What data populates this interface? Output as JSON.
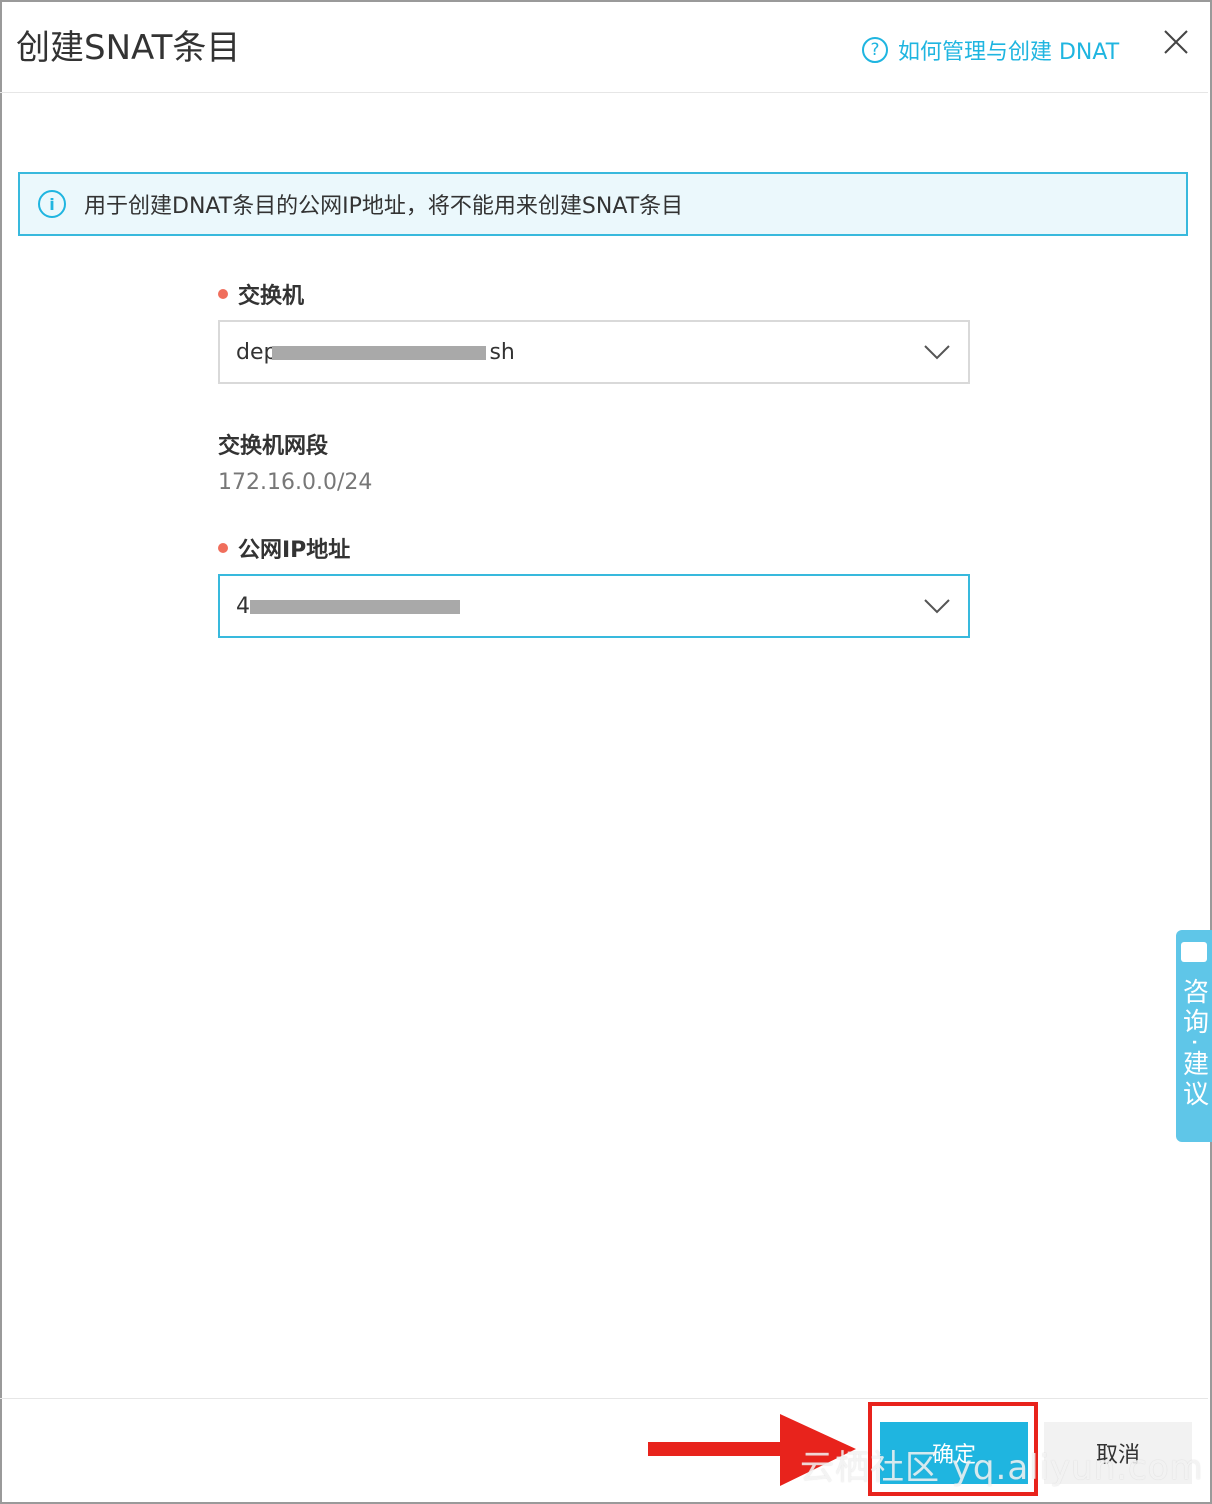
{
  "dialog": {
    "title": "创建SNAT条目",
    "help_link": "如何管理与创建 DNAT",
    "help_icon": "question-circle-icon",
    "close_icon": "close-icon"
  },
  "notice": {
    "icon": "info-circle-icon",
    "text": "用于创建DNAT条目的公网IP地址，将不能用来创建SNAT条目"
  },
  "form": {
    "switch_label": "交换机",
    "switch_value_prefix": "dep",
    "switch_value_suffix": "sh",
    "switch_cidr_label": "交换机网段",
    "switch_cidr_value": "172.16.0.0/24",
    "public_ip_label": "公网IP地址",
    "public_ip_value_prefix": "4"
  },
  "side_tab": {
    "text": "咨询·建议"
  },
  "footer": {
    "confirm_label": "确定",
    "cancel_label": "取消"
  },
  "watermark": {
    "text": "云栖社区 yq.aliyun.com"
  },
  "colors": {
    "accent": "#1fb5e0",
    "required": "#f06e5c",
    "annotation_red": "#e8231c"
  }
}
